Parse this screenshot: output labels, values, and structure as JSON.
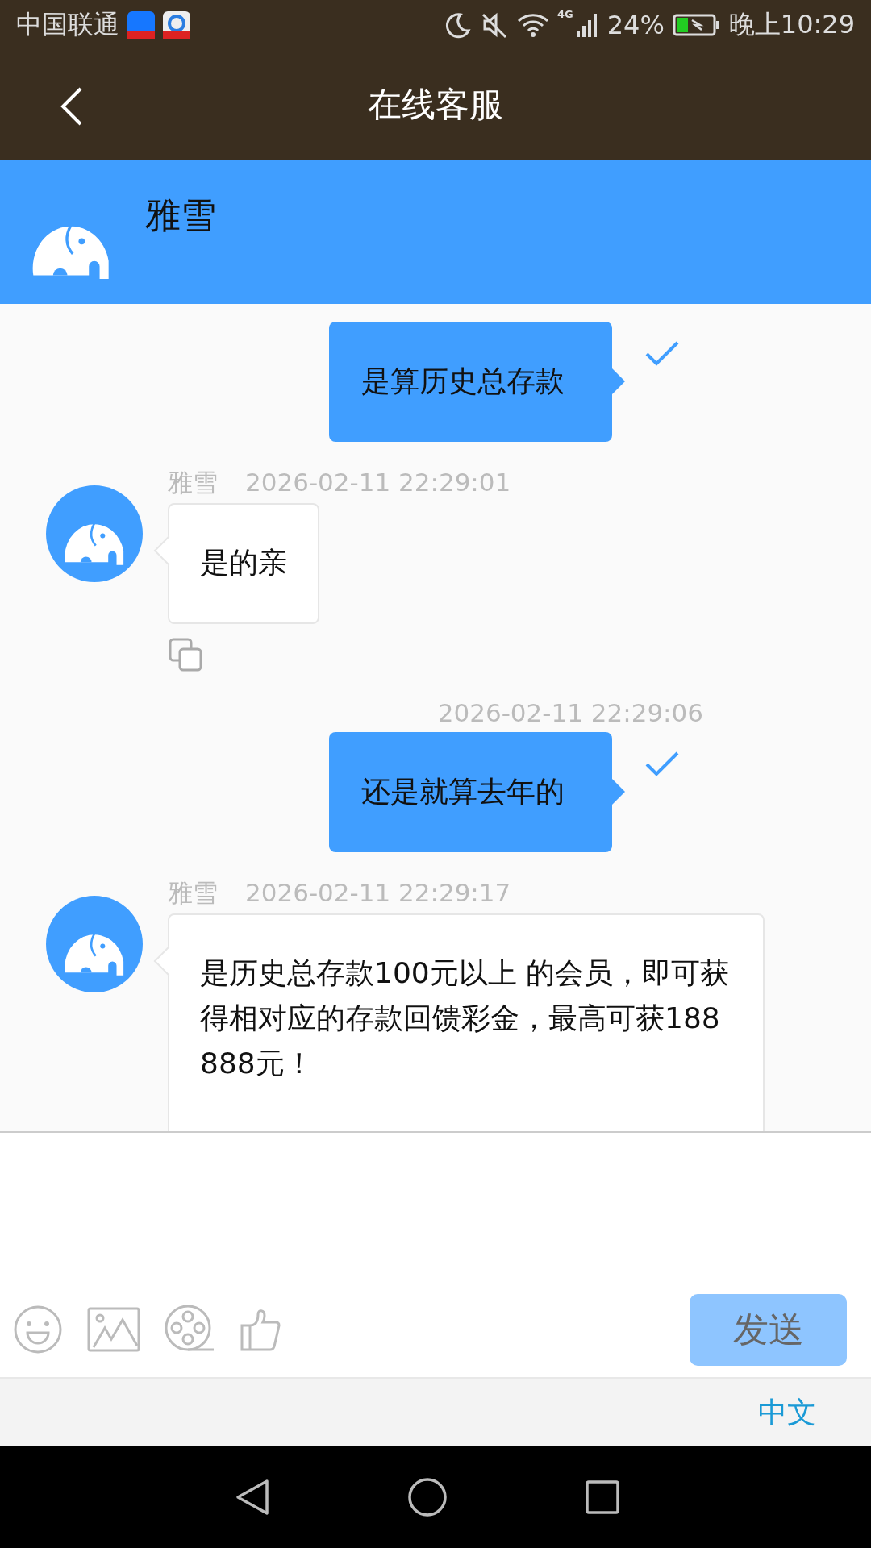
{
  "status_bar": {
    "carrier": "中国联通",
    "network": "4G",
    "battery": "24%",
    "time": "晚上10:29"
  },
  "header": {
    "title": "在线客服"
  },
  "agent": {
    "name": "雅雪"
  },
  "messages": [
    {
      "kind": "outgoing",
      "text": "是算历史总存款",
      "delivered": true
    },
    {
      "kind": "incoming",
      "sender": "雅雪",
      "time": "2026-02-11 22:29:01",
      "text": "是的亲",
      "copyable": true
    },
    {
      "kind": "outgoing",
      "time": "2026-02-11 22:29:06",
      "text": "还是就算去年的",
      "delivered": true
    },
    {
      "kind": "incoming",
      "sender": "雅雪",
      "time": "2026-02-11 22:29:17",
      "text": "是历史总存款100元以上 的会员，即可获得相对应的存款回馈彩金，最高可获188888元！"
    }
  ],
  "composer": {
    "send_button": {
      "label": "发送",
      "disabled": true
    }
  },
  "keyboard": {
    "language": "中文"
  }
}
